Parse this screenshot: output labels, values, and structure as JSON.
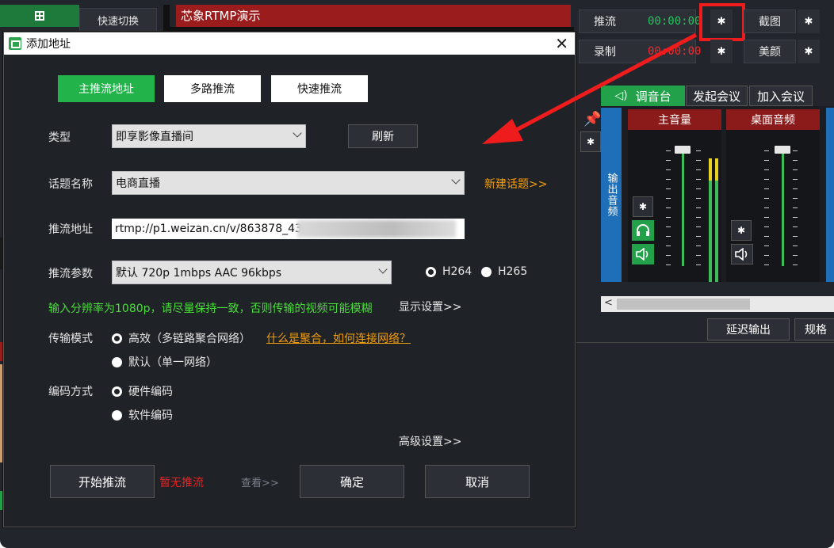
{
  "app": {
    "quick_switch_label": "快速切换",
    "preview_title": "芯象RTMP演示",
    "push": {
      "label": "推流",
      "timer": "00:00:00"
    },
    "record": {
      "label": "录制",
      "timer": "00:00:00"
    },
    "screenshot_label": "截图",
    "beauty_label": "美颜",
    "tabs": {
      "mixer": "调音台",
      "start_meeting": "发起会议",
      "join_meeting": "加入会议"
    },
    "output_audio_label": "输出音频",
    "channels": {
      "master": "主音量",
      "desktop": "桌面音频"
    },
    "delay_output_label": "延迟输出",
    "spec_label": "规格",
    "colors": {
      "accent_green": "#22b34b",
      "timer_green": "#22c55e",
      "timer_red": "#ef2b2b",
      "highlight_red": "#ee1c1c",
      "channel_red": "#8b1a1a",
      "blue": "#1e6fb8"
    }
  },
  "dialog": {
    "title": "添加地址",
    "tabs": {
      "main": "主推流地址",
      "multi": "多路推流",
      "fast": "快速推流"
    },
    "type": {
      "label": "类型",
      "value": "即享影像直播间",
      "refresh": "刷新"
    },
    "topic": {
      "label": "话题名称",
      "value": "电商直播",
      "new_topic_link": "新建话题>>"
    },
    "url": {
      "label": "推流地址",
      "value": "rtmp://p1.weizan.cn/v/863878_434"
    },
    "params": {
      "label": "推流参数",
      "value": "默认 720p 1mbps AAC 96kbps",
      "codec_h264": "H264",
      "codec_h265": "H265"
    },
    "hint": "输入分辨率为1080p，请尽量保持一致，否则传输的视频可能模糊",
    "display_settings": "显示设置>>",
    "transport": {
      "label": "传输模式",
      "opt_efficient": "高效（多链路聚合网络）",
      "opt_default": "默认（单一网络）",
      "help_link": "什么是聚合，如何连接网络？"
    },
    "encoding": {
      "label": "编码方式",
      "opt_hardware": "硬件编码",
      "opt_software": "软件编码"
    },
    "advanced_settings": "高级设置>>",
    "start_push": "开始推流",
    "status": "暂无推流",
    "view": "查看>>",
    "confirm": "确定",
    "cancel": "取消"
  }
}
